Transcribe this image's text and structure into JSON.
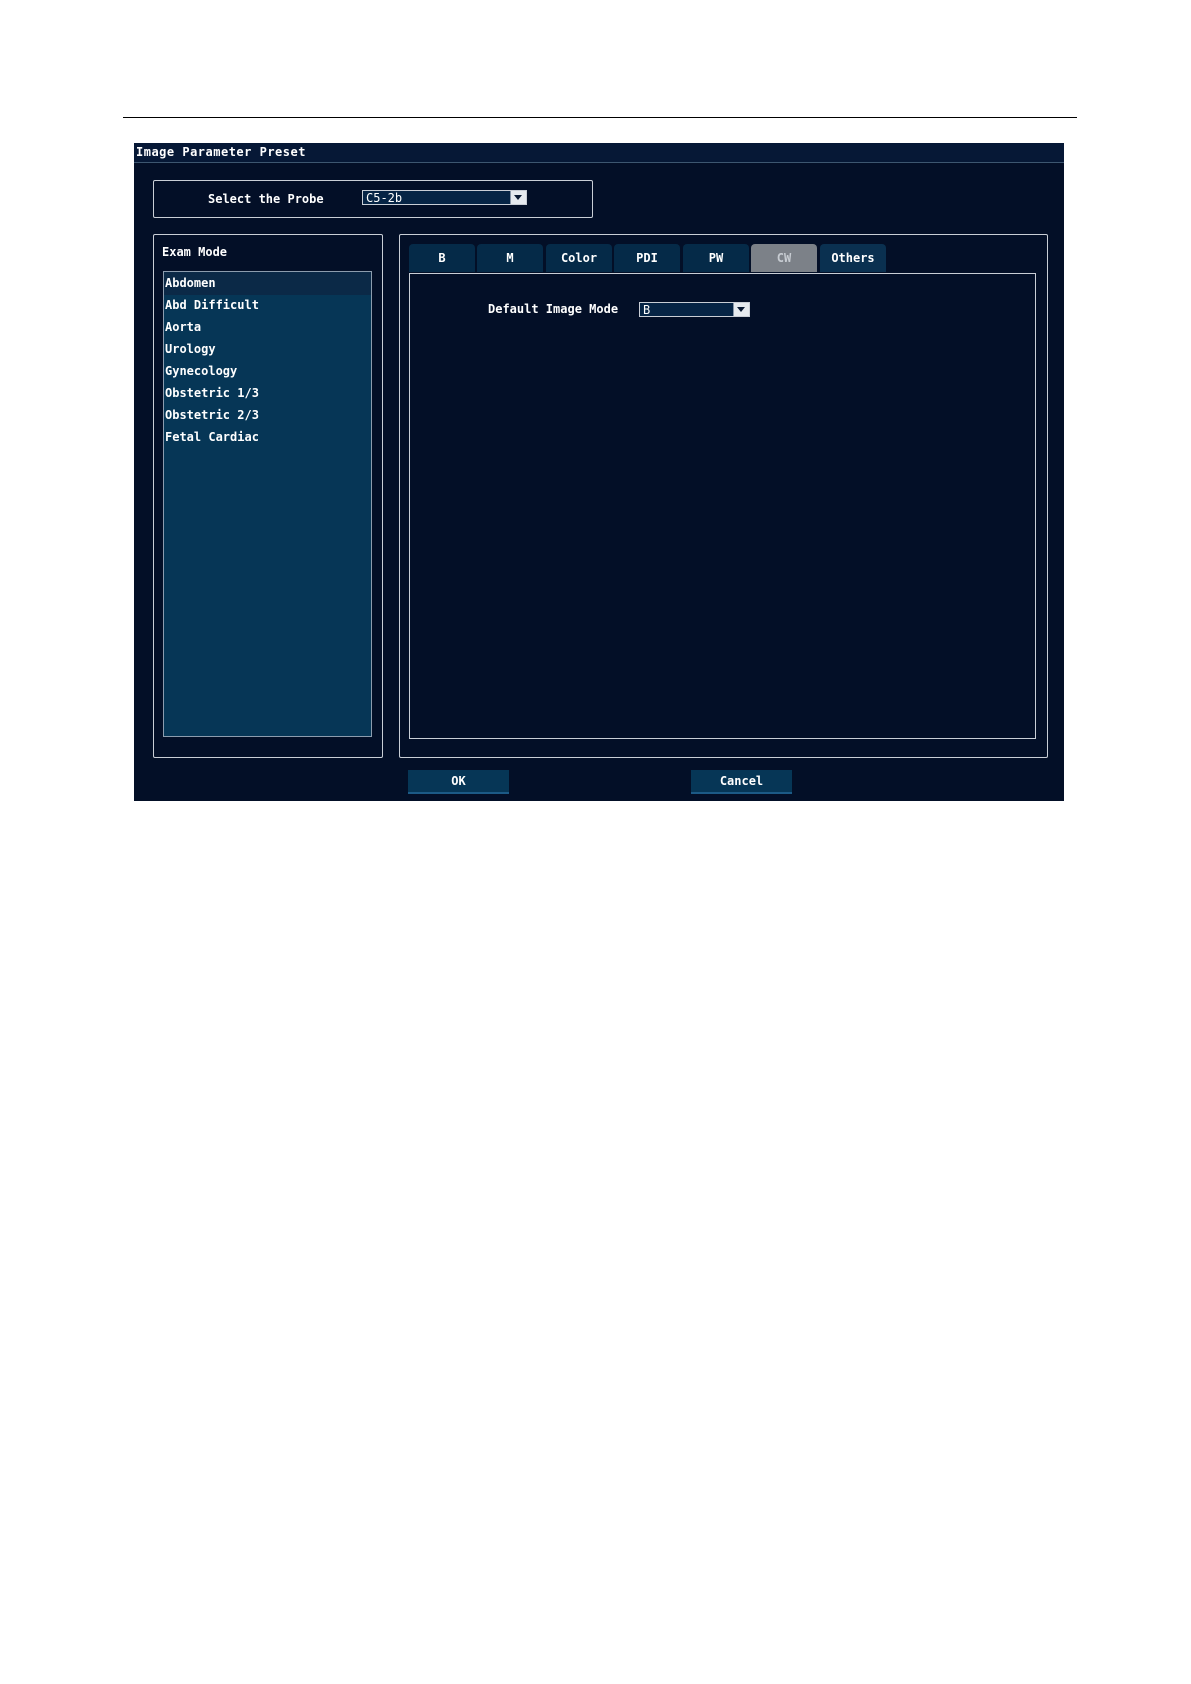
{
  "window": {
    "title": "Image Parameter Preset"
  },
  "probe": {
    "label": "Select the Probe",
    "value": "C5-2b"
  },
  "exam_mode": {
    "title": "Exam Mode",
    "items": [
      "Abdomen",
      "Abd Difficult",
      "Aorta",
      "Urology",
      "Gynecology",
      "Obstetric 1/3",
      "Obstetric 2/3",
      "Fetal Cardiac"
    ],
    "selected": "Abdomen"
  },
  "tabs": {
    "items": [
      "B",
      "M",
      "Color",
      "PDI",
      "PW",
      "CW",
      "Others"
    ],
    "active": "CW"
  },
  "others_panel": {
    "default_mode_label": "Default Image Mode",
    "default_mode_value": "B"
  },
  "buttons": {
    "ok": "OK",
    "cancel": "Cancel"
  },
  "colors": {
    "window_bg": "#030f27",
    "list_bg": "#063656",
    "tab_bg": "#052a48",
    "active_tab": "#7c8188"
  }
}
